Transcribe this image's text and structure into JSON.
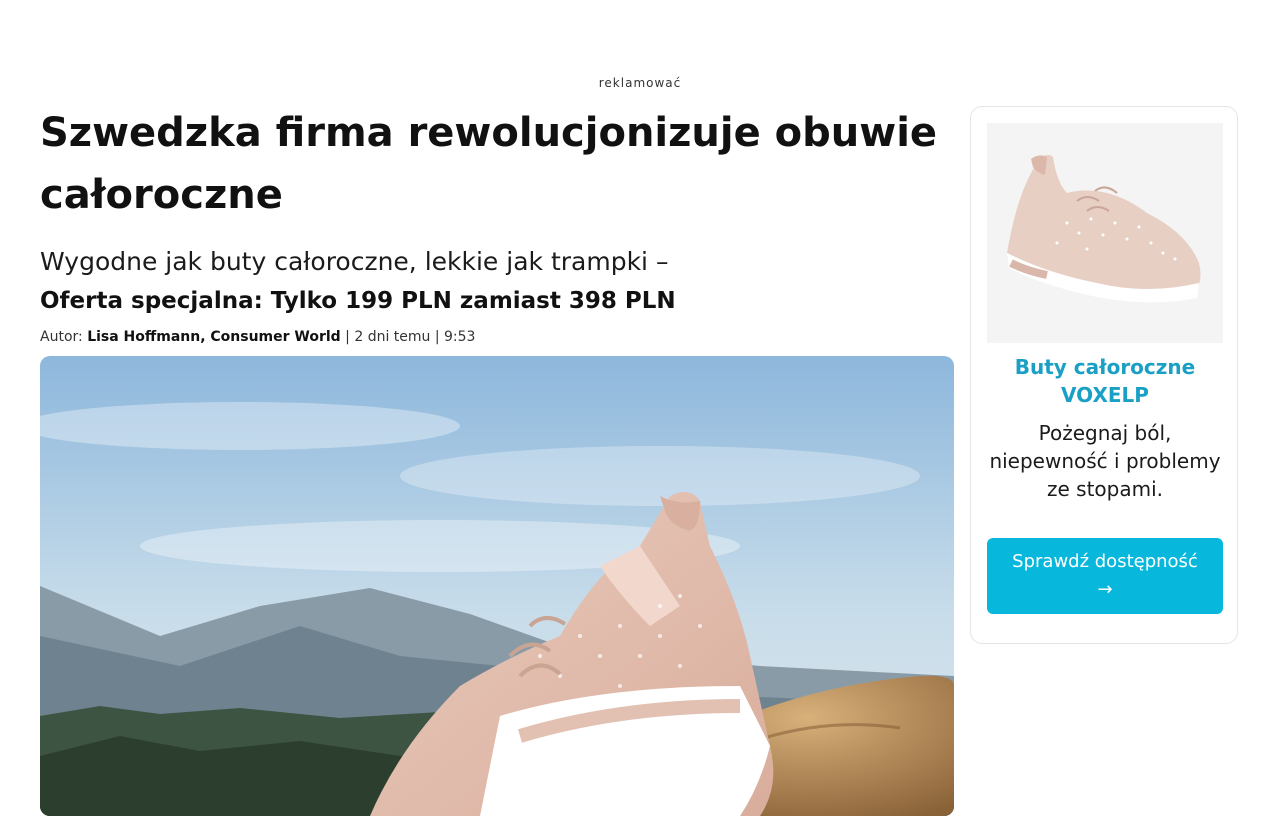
{
  "ad_label": "reklamować",
  "article": {
    "title": "Szwedzka firma rewolucjonizuje obuwie całoroczne",
    "subtitle": "Wygodne jak buty całoroczne, lekkie jak trampki –",
    "offer": "Oferta specjalna: Tylko 199 PLN zamiast 398 PLN",
    "byline": {
      "prefix": "Autor:",
      "author": "Lisa Hoffmann, Consumer World",
      "date": "| 2 dni temu | 9:53"
    }
  },
  "sidebar": {
    "product_name": "Buty całoroczne VOXELP",
    "description": "Pożegnaj ból, niepewność i problemy ze stopami.",
    "cta_label": "Sprawdź dostępność",
    "cta_arrow": "→"
  },
  "colors": {
    "accent": "#08b8dc",
    "product_name": "#1aa0c4"
  }
}
